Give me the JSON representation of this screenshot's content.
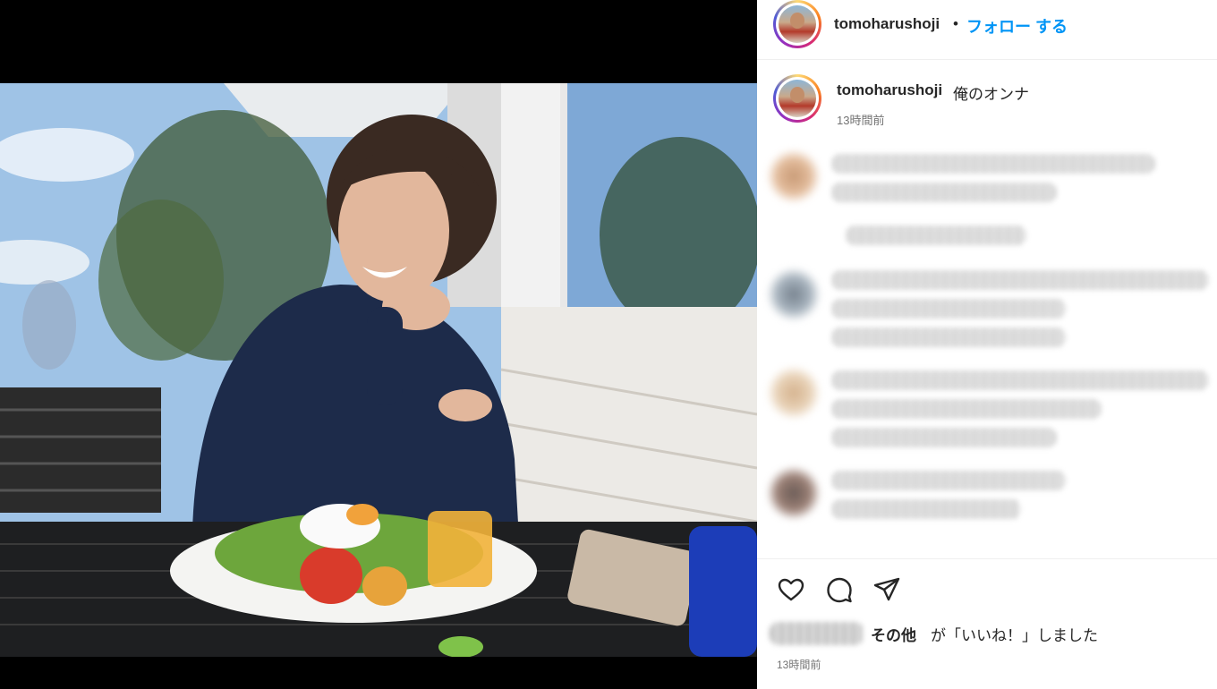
{
  "post": {
    "author": "tomoharushoji",
    "follow_label": "フォロー する",
    "separator": "•",
    "caption": "俺のオンナ",
    "caption_time": "13時間前",
    "likes_others": "その他",
    "likes_suffix": "が「いいね！」しました",
    "post_time": "13時間前"
  },
  "icons": {
    "like": "heart-icon",
    "comment": "comment-icon",
    "share": "share-icon"
  },
  "colors": {
    "follow": "#0095f6",
    "text": "#262626",
    "muted": "#737373",
    "divider": "#efefef"
  }
}
